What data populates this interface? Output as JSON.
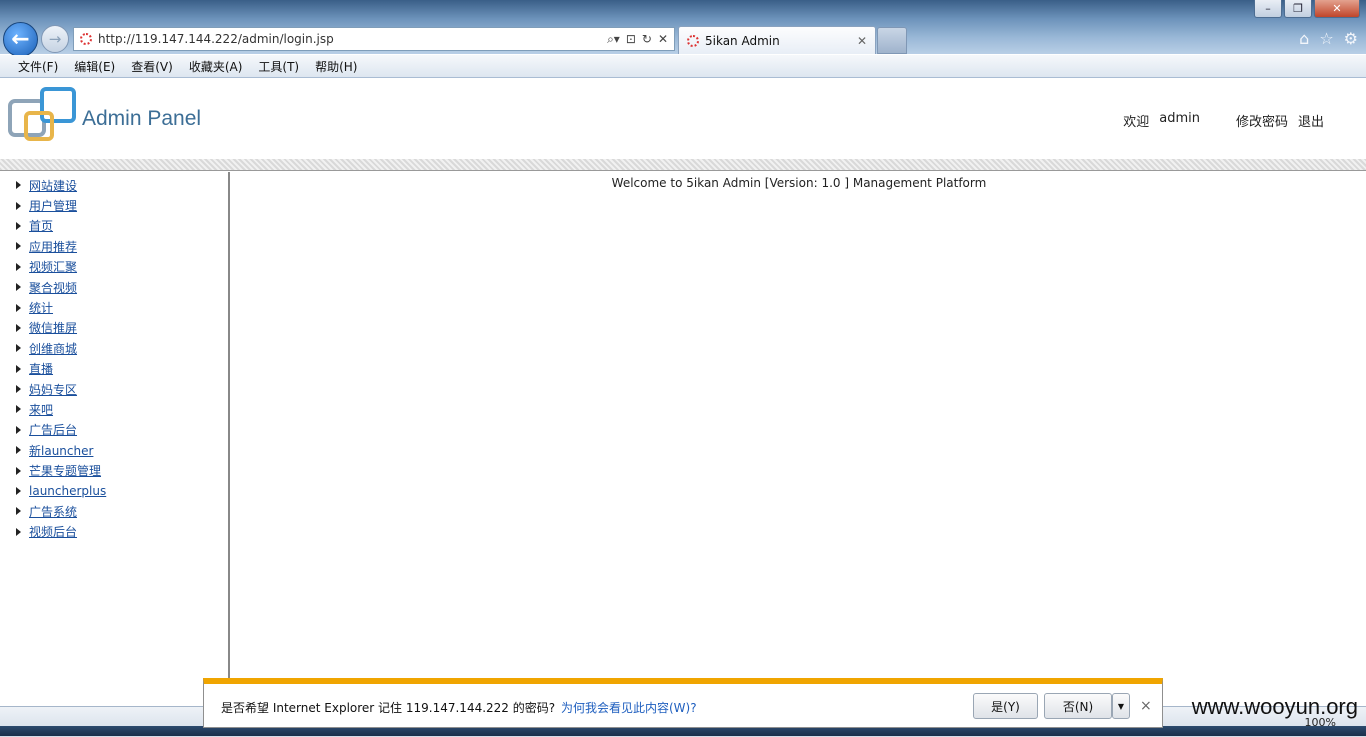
{
  "browser": {
    "url": "http://119.147.144.222/admin/login.jsp",
    "tab_title": "5ikan Admin",
    "window_controls": {
      "minimize": "–",
      "maximize": "❐",
      "close": "✕"
    },
    "address_tools": [
      "⌕▾",
      "⊡",
      "↻",
      "✕"
    ],
    "chrome_icons": [
      "home-icon",
      "star-icon",
      "gear-icon"
    ],
    "menu": [
      "文件(F)",
      "编辑(E)",
      "查看(V)",
      "收藏夹(A)",
      "工具(T)",
      "帮助(H)"
    ]
  },
  "header": {
    "brand": "Admin Panel",
    "welcome_label": "欢迎",
    "username": "admin",
    "change_password": "修改密码",
    "logout": "退出"
  },
  "sidebar": {
    "items": [
      {
        "label": "网站建设"
      },
      {
        "label": "用户管理"
      },
      {
        "label": "首页"
      },
      {
        "label": "应用推荐"
      },
      {
        "label": "视频汇聚"
      },
      {
        "label": "聚合视频"
      },
      {
        "label": "统计"
      },
      {
        "label": "微信推屏"
      },
      {
        "label": "创维商城"
      },
      {
        "label": "直播"
      },
      {
        "label": "妈妈专区"
      },
      {
        "label": "来吧"
      },
      {
        "label": "广告后台"
      },
      {
        "label": "新launcher"
      },
      {
        "label": "芒果专题管理"
      },
      {
        "label": "launcherplus"
      },
      {
        "label": "广告系统"
      },
      {
        "label": "视频后台"
      }
    ]
  },
  "main": {
    "welcome": "Welcome to 5ikan Admin [Version: 1.0 ] Management Platform"
  },
  "notification": {
    "message": "是否希望 Internet Explorer 记住 119.147.144.222 的密码?",
    "why_link": "为何我会看见此内容(W)?",
    "yes": "是(Y)",
    "no": "否(N)",
    "dropdown": "▼",
    "close": "×"
  },
  "status": {
    "zoom": "100%"
  },
  "watermark": "www.wooyun.org"
}
